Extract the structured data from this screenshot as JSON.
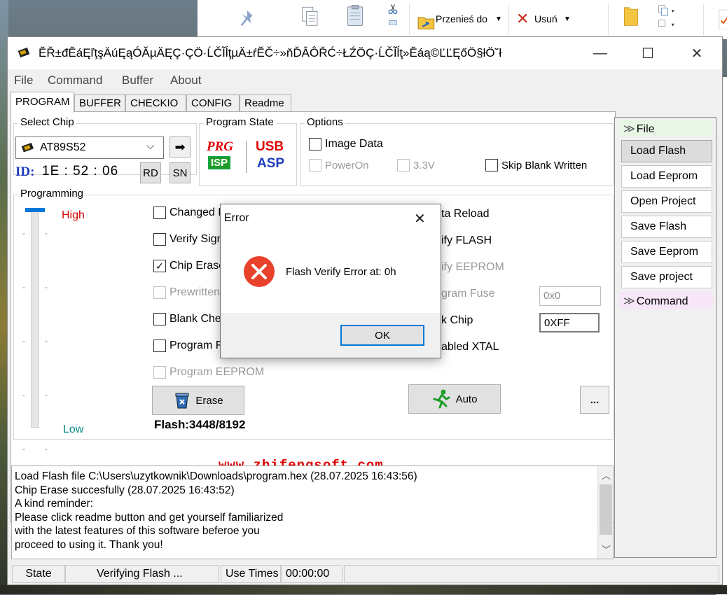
{
  "background": {
    "ribbon": {
      "move_to": "Przenieś do",
      "delete": "Usuń"
    }
  },
  "window": {
    "title": "ĔŘ±đĔáĘľţşÄúĘąÓĂµÄĘÇ·ÇÖ·ĹČĨĺţµÄ±ŕĔČ÷»ňĎÂÔŘĆ÷ŁŹÖÇ·ĹČĨĺţ»Ĕáą©ĽĽĘőÖ§łÖ˘ł",
    "minimize": "—",
    "maximize": "☐",
    "close": "✕"
  },
  "menu": [
    "File",
    "Command",
    "Buffer",
    "About"
  ],
  "tabs": [
    "PROGRAM",
    "BUFFER",
    "CHECKIO",
    "CONFIG",
    "Readme"
  ],
  "select_chip": {
    "label": "Select Chip",
    "chip": "AT89S52",
    "id_label": "ID:",
    "id_value": "1E : 52 : 06",
    "rd": "RD",
    "sn": "SN"
  },
  "program_state": {
    "label": "Program State",
    "prg": "PRG",
    "isp": "ISP",
    "usb": "USB",
    "asp": "ASP"
  },
  "options": {
    "label": "Options",
    "image_data": "Image Data",
    "power_on": "PowerOn",
    "v33": "3.3V",
    "skip_blank": "Skip Blank Written"
  },
  "programming": {
    "label": "Programming",
    "high": "High",
    "low": "Low",
    "speed_level": 1.0,
    "left_options": [
      {
        "label": "Changed D",
        "checked": false,
        "disabled": false
      },
      {
        "label": "Verify Sign",
        "checked": false,
        "disabled": false
      },
      {
        "label": "Chip Erase",
        "checked": true,
        "disabled": false
      },
      {
        "label": "Prewritten",
        "checked": false,
        "disabled": true
      },
      {
        "label": "Blank Chec",
        "checked": false,
        "disabled": false
      },
      {
        "label": "Program F",
        "checked": false,
        "disabled": false
      },
      {
        "label": "Program EEPROM",
        "checked": false,
        "disabled": true
      }
    ],
    "right_options": [
      {
        "label": "ta Reload",
        "disabled": false
      },
      {
        "label": "ify FLASH",
        "disabled": false
      },
      {
        "label": "ify EEPROM",
        "disabled": true
      },
      {
        "label": "gram Fuse",
        "disabled": true
      },
      {
        "label": "k Chip",
        "disabled": false
      },
      {
        "label": "abled XTAL",
        "disabled": false
      }
    ],
    "fuse_value": "0x0",
    "lock_value": "0XFF",
    "erase": "Erase",
    "auto": "Auto",
    "more": "...",
    "flash_info": "Flash:3448/8192"
  },
  "website": "www.zhifengsoft.com",
  "side_panel": {
    "file_header": "File",
    "buttons": [
      "Load Flash",
      "Load Eeprom",
      "Open Project",
      "Save Flash",
      "Save Eeprom",
      "Save project"
    ],
    "command_header": "Command"
  },
  "log": [
    "Load Flash file C:\\Users\\uzytkownik\\Downloads\\program.hex (28.07.2025 16:43:56)",
    "Chip Erase succesfully (28.07.2025 16:43:52)",
    "A kind reminder:",
    "Please click readme button and get yourself familiarized",
    "with the latest features of this software beferoe you",
    "proceed to using it. Thank you!"
  ],
  "status_bar": {
    "state_label": "State",
    "state_value": "Verifying Flash ...",
    "use_times_label": "Use Times",
    "use_times_value": "00:00:00"
  },
  "dialog": {
    "title": "Error",
    "message": "Flash Verify Error at: 0h",
    "ok": "OK"
  }
}
